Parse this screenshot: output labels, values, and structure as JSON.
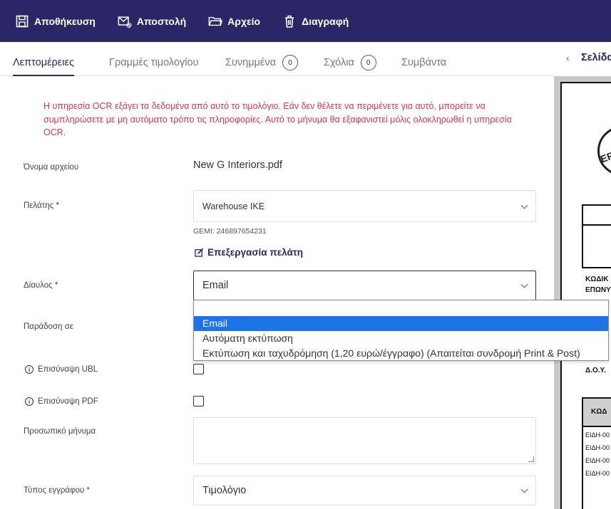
{
  "toolbar": {
    "save": "Αποθήκευση",
    "send": "Αποστολή",
    "archive": "Αρχείο",
    "delete": "Διαγραφή"
  },
  "tabs": [
    {
      "label": "Λεπτομέρειες"
    },
    {
      "label": "Γραμμές τιμολογίου"
    },
    {
      "label": "Συνημμένα",
      "count": "0"
    },
    {
      "label": "Σχόλια",
      "count": "0"
    },
    {
      "label": "Συμβάντα"
    }
  ],
  "preview": {
    "page_label": "Σελίδα",
    "doc_texts": [
      "ΚΩΔΙΚ",
      "ΕΠΩΝΥ",
      "Δ.Ο.Υ.",
      "ΚΩΔ",
      "ΕΙΔΗ-00",
      "ΕΙΔΗ-00",
      "ΕΙΔΗ-00",
      "ΕΙΔΗ-00"
    ],
    "seal_text": "ERI"
  },
  "ocr_message": "Η υπηρεσία OCR εξάγει τα δεδομένα από αυτό το τιμολόγιο. Εάν δεν θέλετε να περιμένετε για αυτό, μπορείτε να συμπληρώσετε με μη αυτόματο τρόπο τις πληροφορίες. Αυτό το μήνυμα θα εξαφανιστεί μόλις ολοκληρωθεί η υπηρεσία OCR.",
  "form": {
    "filename_label": "Όνομα αρχείου",
    "filename_value": "New G Interiors.pdf",
    "client_label": "Πελάτης *",
    "client_value": "Warehouse IKE",
    "gemi": "GEMI: 246897654231",
    "edit_client": "Επεξεργασία πελάτη",
    "channel_label": "Δίαυλος *",
    "channel_value": "Email",
    "delivery_label": "Παράδοση σε",
    "ubl_label": "Επισύναψη UBL",
    "pdf_label": "Επισύναψη PDF",
    "message_label": "Προσωπικό μήνυμα",
    "doctype_label": "Τύπος εγγράφου *",
    "doctype_value": "Τιμολόγιο"
  },
  "channel_options": [
    "Email",
    "Αυτόματη εκτύπωση",
    "Εκτύπωση και ταχυδρόμηση (1,20 ευρώ/έγγραφο) (Απαιτείται συνδρομή Print & Post)"
  ]
}
